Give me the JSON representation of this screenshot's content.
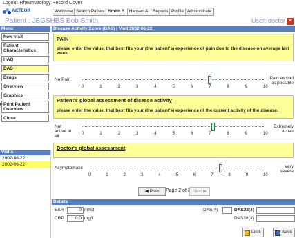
{
  "topline": {
    "logout": "Logout",
    "app": "Rheumatology Record Cover"
  },
  "logo": {
    "text": "METEOR"
  },
  "tabs": [
    "Welcome",
    "Search Patient",
    "Smith B.",
    "Hansen A.",
    "Reports",
    "Profile",
    "Administrate"
  ],
  "patient": {
    "title": "Patient : JBGSHBS Bob Smith"
  },
  "user": {
    "title": "User: doctor"
  },
  "menu": {
    "header": "Menu",
    "items": [
      "New visit",
      "Patient Characteristics",
      "HAQ",
      "DAS",
      "Drugs",
      "Overview",
      "Graphics",
      "Print Patient Overview",
      "Close"
    ]
  },
  "visits": {
    "header": "Visits",
    "items": [
      "2007-06-22",
      "2002-06-22"
    ]
  },
  "main": {
    "header": "Disease Activity Score (DAS) | Visit 2002-06-22",
    "q1": {
      "title": "PAIN",
      "text": "please enter the value, that best fits your (the patient's) experience of pain due to the disease on average last week.",
      "left": "No Pain",
      "right": "Pain as bad as possible"
    },
    "q2": {
      "title": "Patient's global assessment of disease activity",
      "text": "please enter the value, that best fits your (the patient's) experience of the current activity of the disease.",
      "left": "Not active at all",
      "right": "Extremely active"
    },
    "q3": {
      "title": "Doctor's global assessment",
      "left": "Asymptomatic",
      "right": "Very severe"
    },
    "ticks": [
      "0",
      "1",
      "2",
      "3",
      "4",
      "5",
      "6",
      "7",
      "8",
      "9",
      "10"
    ],
    "nav": {
      "prev": "Prev",
      "page": "Page 2 of 2",
      "next": "Next"
    }
  },
  "slider_values": {
    "q1": 7,
    "q2": 7.2,
    "q3": 7.5
  },
  "details": {
    "header": "Details",
    "esr_label": "ESR",
    "esr_value": "0",
    "esr_unit": "mm/t",
    "crp_label": "CRP",
    "crp_value": "0.0",
    "crp_unit": "mg/l",
    "das4_label": "DAS(4)",
    "das28_4_label": "DAS28(4)",
    "das28_3_label": "DAS28(3)",
    "lock": "Lock",
    "save": "Save"
  },
  "colors": {
    "accent": "#5a7fc0",
    "highlight": "#ffff99"
  }
}
